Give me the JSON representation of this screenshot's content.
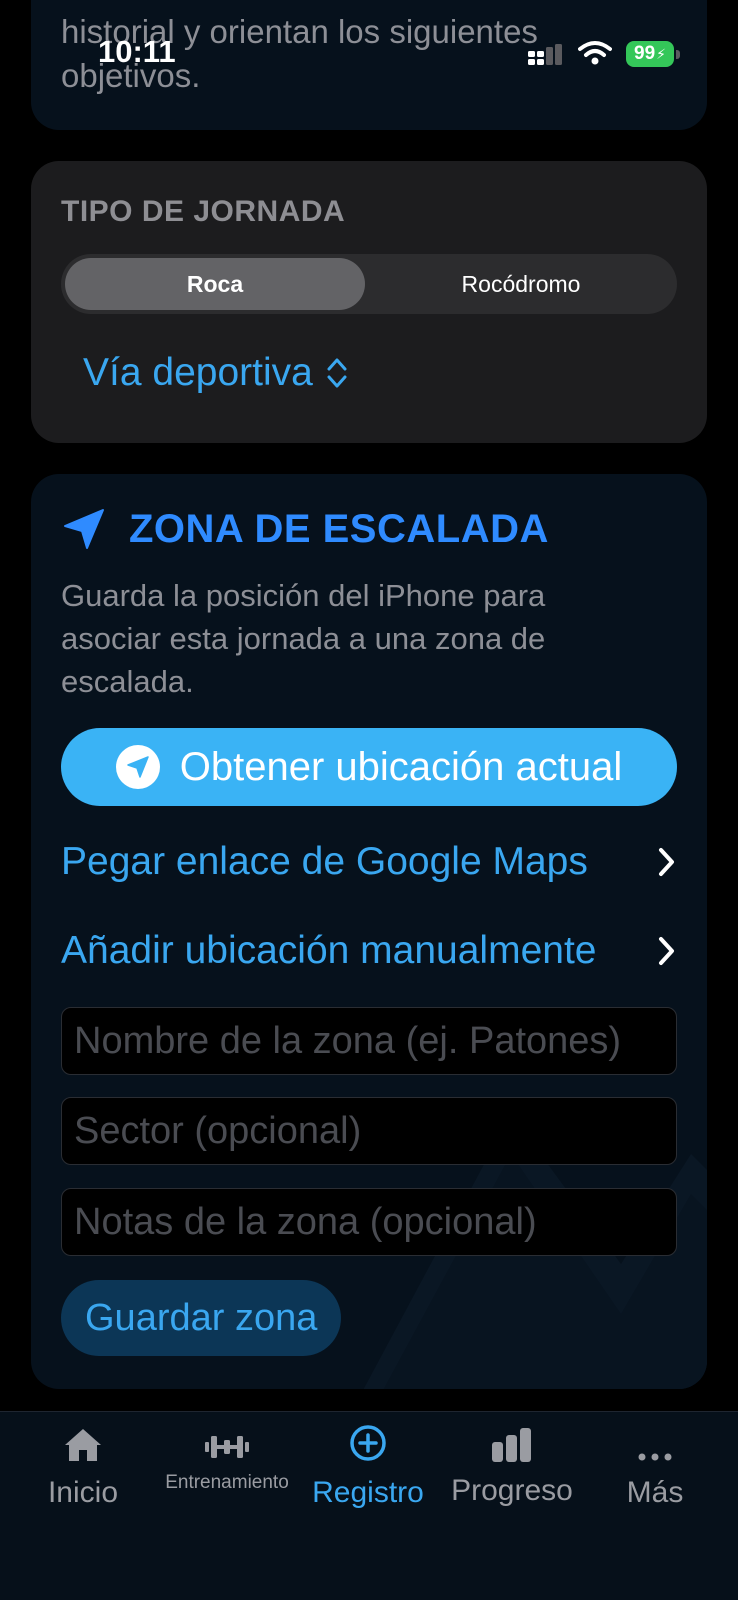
{
  "status_bar": {
    "time": "10:11",
    "battery": "99"
  },
  "intro": {
    "text": "historial y orientan los siguientes objetivos."
  },
  "jornada": {
    "title": "TIPO DE JORNADA",
    "segments": [
      {
        "label": "Roca",
        "selected": true
      },
      {
        "label": "Rocódromo",
        "selected": false
      }
    ],
    "picker_value": "Vía deportiva"
  },
  "zona": {
    "title": "ZONA DE ESCALADA",
    "description": "Guarda la posición del iPhone para asociar esta jornada a una zona de escalada.",
    "location_button": "Obtener ubicación actual",
    "links": [
      {
        "label": "Pegar enlace de Google Maps"
      },
      {
        "label": "Añadir ubicación manualmente"
      }
    ],
    "fields": {
      "name": {
        "placeholder": "Nombre de la zona (ej. Patones)",
        "value": ""
      },
      "sector": {
        "placeholder": "Sector (opcional)",
        "value": ""
      },
      "notes": {
        "placeholder": "Notas de la zona (opcional)",
        "value": ""
      }
    },
    "save_button": "Guardar zona"
  },
  "tabbar": {
    "items": [
      {
        "label": "Inicio",
        "icon": "house-icon",
        "active": false
      },
      {
        "label": "Entrenamiento",
        "icon": "dumbbell-icon",
        "active": false
      },
      {
        "label": "Registro",
        "icon": "plus-circle-icon",
        "active": true
      },
      {
        "label": "Progreso",
        "icon": "chart-bar-icon",
        "active": false
      },
      {
        "label": "Más",
        "icon": "ellipsis-icon",
        "active": false
      }
    ]
  },
  "colors": {
    "accent": "#3aa7f0",
    "zone_title": "#2f8bff",
    "primary_button": "#3ab3f5",
    "battery": "#34c759"
  }
}
